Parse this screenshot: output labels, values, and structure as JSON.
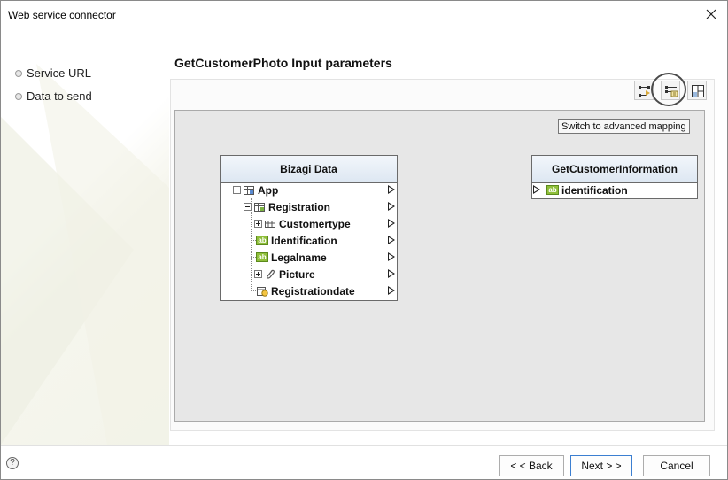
{
  "window": {
    "title": "Web service connector"
  },
  "nav": {
    "items": [
      {
        "label": "Service URL"
      },
      {
        "label": "Data to send"
      }
    ]
  },
  "main": {
    "heading": "GetCustomerPhoto Input parameters",
    "tooltip": "Switch to advanced mapping",
    "left_table": {
      "title": "Bizagi Data",
      "rows": [
        {
          "label": "App"
        },
        {
          "label": "Registration"
        },
        {
          "label": "Customertype"
        },
        {
          "label": "Identification"
        },
        {
          "label": "Legalname"
        },
        {
          "label": "Picture"
        },
        {
          "label": "Registrationdate"
        }
      ]
    },
    "right_table": {
      "title": "GetCustomerInformation",
      "rows": [
        {
          "label": "identification"
        }
      ]
    }
  },
  "footer": {
    "back_label": "< < Back",
    "next_label": "Next > >",
    "cancel_label": "Cancel",
    "help_label": "?"
  },
  "colors": {
    "header_gradient_top": "#f2f6fb",
    "header_gradient_bottom": "#dde7f2",
    "text_icon_green": "#8fbf3a"
  }
}
